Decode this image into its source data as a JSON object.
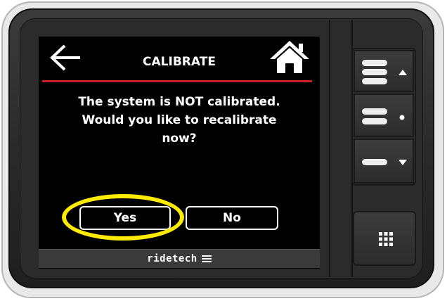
{
  "screen": {
    "title": "CALIBRATE",
    "message_line1": "The system is NOT calibrated.",
    "message_line2": "Would you like to recalibrate",
    "message_line3": "now?",
    "yes_label": "Yes",
    "no_label": "No"
  },
  "brand": {
    "name": "ridetech"
  },
  "icons": {
    "back": "back-arrow-icon",
    "home": "home-icon",
    "grid": "grid-icon"
  },
  "colors": {
    "accent_red": "#cc1f2a",
    "highlight": "#ffeb00",
    "screen_bg": "#000000",
    "text": "#ffffff"
  }
}
